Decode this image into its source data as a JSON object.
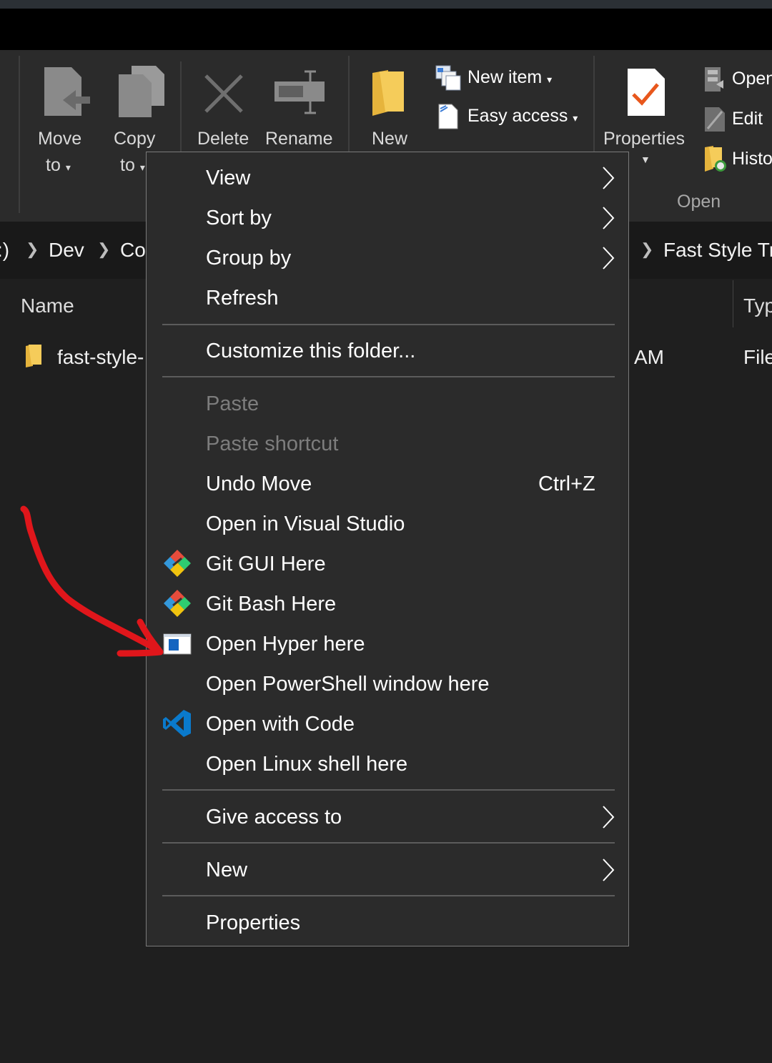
{
  "ribbon": {
    "move_label": "Move",
    "move_to_label": "to",
    "copy_label": "Copy",
    "copy_to_label": "to",
    "delete_label": "Delete",
    "rename_label": "Rename",
    "new_label": "New",
    "new_item_label": "New item",
    "easy_access_label": "Easy access",
    "properties_label": "Properties",
    "open_label": "Open",
    "edit_label": "Edit",
    "history_label": "Histo",
    "open_group_label": "Open"
  },
  "breadcrumb": {
    "drive": ":)",
    "dev": "Dev",
    "co": "Co",
    "current": "Fast Style Tr"
  },
  "list": {
    "col_name": "Name",
    "col_type": "Typ",
    "rows": [
      {
        "name": "fast-style-",
        "date_tail": "AM",
        "type": "File"
      }
    ]
  },
  "context_menu": {
    "items": [
      {
        "label": "View",
        "submenu": true
      },
      {
        "label": "Sort by",
        "submenu": true
      },
      {
        "label": "Group by",
        "submenu": true
      },
      {
        "label": "Refresh"
      },
      {
        "label": "Customize this folder..."
      },
      {
        "label": "Paste",
        "disabled": true
      },
      {
        "label": "Paste shortcut",
        "disabled": true
      },
      {
        "label": "Undo Move",
        "shortcut": "Ctrl+Z"
      },
      {
        "label": "Open in Visual Studio"
      },
      {
        "label": "Git GUI Here",
        "icon": "git-icon"
      },
      {
        "label": "Git Bash Here",
        "icon": "git-icon"
      },
      {
        "label": "Open Hyper here",
        "icon": "hyper-icon"
      },
      {
        "label": "Open PowerShell window here"
      },
      {
        "label": "Open with Code",
        "icon": "vscode-icon"
      },
      {
        "label": "Open Linux shell here"
      },
      {
        "label": "Give access to",
        "submenu": true
      },
      {
        "label": "New",
        "submenu": true
      },
      {
        "label": "Properties"
      }
    ]
  },
  "annotation": {
    "color": "#e0161b",
    "icon": "red-arrow-annotation"
  },
  "colors": {
    "folder": "#f0c24b",
    "properties_check": "#e8571c",
    "vscode": "#0a7acc"
  }
}
